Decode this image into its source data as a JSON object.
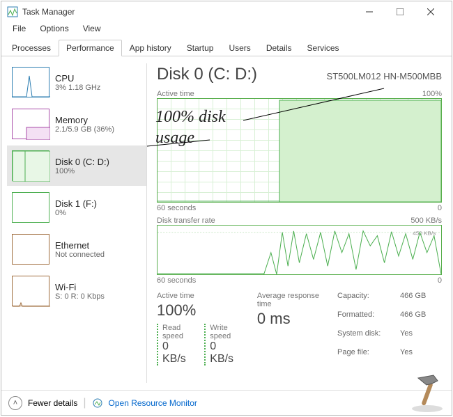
{
  "window": {
    "title": "Task Manager"
  },
  "menubar": {
    "file": "File",
    "options": "Options",
    "view": "View"
  },
  "tabs": {
    "processes": "Processes",
    "performance": "Performance",
    "apphistory": "App history",
    "startup": "Startup",
    "users": "Users",
    "details": "Details",
    "services": "Services"
  },
  "sidebar": {
    "cpu": {
      "name": "CPU",
      "sub": "3%  1.18 GHz"
    },
    "memory": {
      "name": "Memory",
      "sub": "2.1/5.9 GB (36%)"
    },
    "disk0": {
      "name": "Disk 0 (C: D:)",
      "sub": "100%"
    },
    "disk1": {
      "name": "Disk 1 (F:)",
      "sub": "0%"
    },
    "ethernet": {
      "name": "Ethernet",
      "sub": "Not connected"
    },
    "wifi": {
      "name": "Wi-Fi",
      "sub": "S: 0 R: 0 Kbps"
    }
  },
  "main": {
    "title": "Disk 0 (C: D:)",
    "model": "ST500LM012 HN-M500MBB",
    "graph1": {
      "label": "Active time",
      "max": "100%",
      "xleft": "60 seconds",
      "xright": "0"
    },
    "graph2": {
      "label": "Disk transfer rate",
      "max": "500 KB/s",
      "mark": "450 KB/s",
      "xleft": "60 seconds",
      "xright": "0"
    },
    "stats": {
      "active_time_lab": "Active time",
      "active_time_val": "100%",
      "resp_lab": "Average response time",
      "resp_val": "0 ms",
      "read_lab": "Read speed",
      "read_val": "0 KB/s",
      "write_lab": "Write speed",
      "write_val": "0 KB/s"
    },
    "kv": {
      "capacity_k": "Capacity:",
      "capacity_v": "466 GB",
      "formatted_k": "Formatted:",
      "formatted_v": "466 GB",
      "sysdisk_k": "System disk:",
      "sysdisk_v": "Yes",
      "pagefile_k": "Page file:",
      "pagefile_v": "Yes"
    }
  },
  "footer": {
    "fewer": "Fewer details",
    "orm": "Open Resource Monitor"
  },
  "annotation": {
    "line1": "100% disk",
    "line2": "usage"
  },
  "chart_data": [
    {
      "type": "area",
      "title": "Active time",
      "ylabel": "Active time (%)",
      "ylim": [
        0,
        100
      ],
      "x_range_seconds": [
        60,
        0
      ],
      "series": [
        {
          "name": "Active time %",
          "values": [
            0,
            0,
            0,
            0,
            0,
            0,
            0,
            0,
            0,
            0,
            0,
            0,
            0,
            0,
            0,
            0,
            0,
            0,
            0,
            0,
            0,
            0,
            0,
            0,
            0,
            0,
            100,
            100,
            100,
            100,
            100,
            100,
            100,
            100,
            100,
            100,
            100,
            100,
            100,
            100,
            100,
            100,
            100,
            100,
            100,
            100,
            100,
            100,
            100,
            100,
            100,
            100,
            100,
            100,
            100,
            100,
            100,
            100,
            100,
            100
          ]
        }
      ]
    },
    {
      "type": "line",
      "title": "Disk transfer rate",
      "ylabel": "KB/s",
      "ylim": [
        0,
        500
      ],
      "x_range_seconds": [
        60,
        0
      ],
      "annotations": [
        "450 KB/s"
      ],
      "series": [
        {
          "name": "Transfer rate KB/s",
          "values": [
            0,
            0,
            0,
            0,
            0,
            0,
            0,
            0,
            0,
            0,
            0,
            0,
            0,
            0,
            0,
            0,
            0,
            0,
            0,
            0,
            0,
            0,
            40,
            0,
            120,
            30,
            420,
            60,
            450,
            40,
            380,
            90,
            440,
            30,
            410,
            120,
            380,
            60,
            450,
            80,
            420,
            40,
            460,
            150,
            370,
            70,
            440,
            30,
            400,
            50,
            450,
            60,
            380,
            90,
            420,
            40,
            430,
            60,
            410,
            0
          ]
        }
      ]
    }
  ]
}
